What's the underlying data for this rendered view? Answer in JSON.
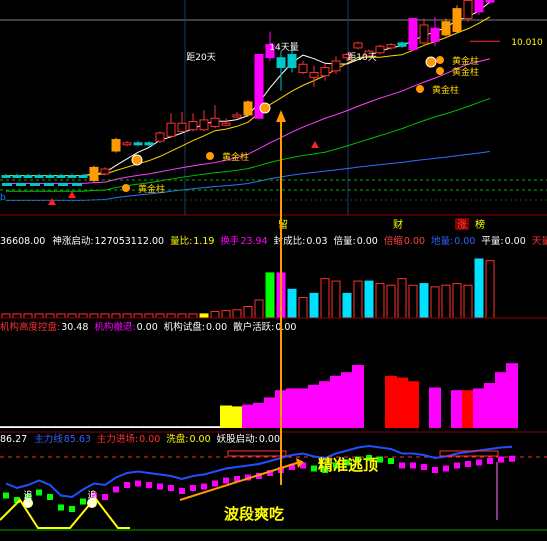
{
  "chart_data": [
    {
      "type": "candlestick",
      "panel": "price",
      "ylim": [
        0,
        11
      ],
      "price_level_label": "10.010",
      "price_level": 10.01,
      "candles": [
        {
          "o": 1.8,
          "c": 1.8,
          "h": 1.9,
          "l": 1.7,
          "col": "#00c8c8"
        },
        {
          "o": 1.8,
          "c": 1.8,
          "h": 1.9,
          "l": 1.7,
          "col": "#00c8c8"
        },
        {
          "o": 1.8,
          "c": 1.8,
          "h": 1.9,
          "l": 1.7,
          "col": "#00c8c8"
        },
        {
          "o": 1.8,
          "c": 1.8,
          "h": 1.9,
          "l": 1.7,
          "col": "#00c8c8"
        },
        {
          "o": 1.8,
          "c": 1.8,
          "h": 1.9,
          "l": 1.7,
          "col": "#00c8c8"
        },
        {
          "o": 1.8,
          "c": 1.8,
          "h": 1.9,
          "l": 1.7,
          "col": "#00c8c8"
        },
        {
          "o": 1.8,
          "c": 1.8,
          "h": 1.9,
          "l": 1.7,
          "col": "#00c8c8"
        },
        {
          "o": 1.8,
          "c": 1.8,
          "h": 1.9,
          "l": 1.7,
          "col": "#00c8c8"
        },
        {
          "o": 1.5,
          "c": 2.3,
          "h": 2.4,
          "l": 1.4,
          "col": "#ff9a00"
        },
        {
          "o": 1.9,
          "c": 2.2,
          "h": 2.3,
          "l": 1.8,
          "col": "#ff3030"
        },
        {
          "o": 3.3,
          "c": 4.0,
          "h": 4.1,
          "l": 3.2,
          "col": "#ff9a00"
        },
        {
          "o": 3.7,
          "c": 3.8,
          "h": 3.9,
          "l": 3.6,
          "col": "#ff3030"
        },
        {
          "o": 3.7,
          "c": 3.8,
          "h": 3.9,
          "l": 3.6,
          "col": "#00c8c8"
        },
        {
          "o": 3.7,
          "c": 3.8,
          "h": 3.9,
          "l": 3.6,
          "col": "#00c8c8"
        },
        {
          "o": 3.9,
          "c": 4.4,
          "h": 4.5,
          "l": 3.8,
          "col": "#ff3030"
        },
        {
          "o": 4.2,
          "c": 5.0,
          "h": 5.6,
          "l": 4.1,
          "col": "#ff3030"
        },
        {
          "o": 4.5,
          "c": 5.0,
          "h": 5.7,
          "l": 4.4,
          "col": "#ff3030"
        },
        {
          "o": 4.6,
          "c": 5.1,
          "h": 5.6,
          "l": 4.5,
          "col": "#ff3030"
        },
        {
          "o": 4.6,
          "c": 5.2,
          "h": 5.8,
          "l": 4.5,
          "col": "#ff3030"
        },
        {
          "o": 4.8,
          "c": 5.3,
          "h": 6.1,
          "l": 4.7,
          "col": "#ff3030"
        },
        {
          "o": 5.0,
          "c": 5.0,
          "h": 5.3,
          "l": 4.8,
          "col": "#ff3030"
        },
        {
          "o": 5.4,
          "c": 5.5,
          "h": 5.7,
          "l": 5.3,
          "col": "#ff3030"
        },
        {
          "o": 5.5,
          "c": 6.3,
          "h": 6.4,
          "l": 5.4,
          "col": "#ff9a00"
        },
        {
          "o": 5.3,
          "c": 9.2,
          "h": 9.2,
          "l": 5.3,
          "col": "#ff00ff"
        },
        {
          "o": 9.0,
          "c": 9.8,
          "h": 10.6,
          "l": 8.8,
          "col": "#ff00ff"
        },
        {
          "o": 8.4,
          "c": 9.0,
          "h": 9.4,
          "l": 7.0,
          "col": "#00c8c8"
        },
        {
          "o": 8.4,
          "c": 9.2,
          "h": 9.9,
          "l": 8.1,
          "col": "#00c8c8"
        },
        {
          "o": 8.1,
          "c": 8.6,
          "h": 8.8,
          "l": 8.0,
          "col": "#ff3030"
        },
        {
          "o": 7.8,
          "c": 8.1,
          "h": 8.5,
          "l": 7.2,
          "col": "#ff3030"
        },
        {
          "o": 7.9,
          "c": 8.4,
          "h": 8.6,
          "l": 7.6,
          "col": "#ff3030"
        },
        {
          "o": 8.2,
          "c": 8.8,
          "h": 9.1,
          "l": 8.0,
          "col": "#ff3030"
        },
        {
          "o": 9.0,
          "c": 9.2,
          "h": 9.3,
          "l": 8.8,
          "col": "#ff3030"
        },
        {
          "o": 9.6,
          "c": 9.9,
          "h": 10.0,
          "l": 9.5,
          "col": "#ff3030"
        },
        {
          "o": 9.1,
          "c": 9.4,
          "h": 9.5,
          "l": 9.0,
          "col": "#ff3030"
        },
        {
          "o": 9.3,
          "c": 9.7,
          "h": 9.8,
          "l": 9.2,
          "col": "#ff3030"
        },
        {
          "o": 9.6,
          "c": 9.8,
          "h": 9.9,
          "l": 9.5,
          "col": "#ff3030"
        },
        {
          "o": 9.7,
          "c": 9.9,
          "h": 10.0,
          "l": 9.6,
          "col": "#00c8c8"
        },
        {
          "o": 9.5,
          "c": 11.4,
          "h": 11.4,
          "l": 9.4,
          "col": "#ff00ff"
        },
        {
          "o": 9.9,
          "c": 11.0,
          "h": 11.4,
          "l": 9.8,
          "col": "#ff3030"
        },
        {
          "o": 10.0,
          "c": 10.8,
          "h": 11.5,
          "l": 9.7,
          "col": "#ff00ff"
        },
        {
          "o": 10.4,
          "c": 11.2,
          "h": 11.4,
          "l": 10.3,
          "col": "#ff9a00"
        },
        {
          "o": 10.6,
          "c": 12.0,
          "h": 12.2,
          "l": 10.5,
          "col": "#ff9a00"
        },
        {
          "o": 11.4,
          "c": 12.5,
          "h": 12.8,
          "l": 11.2,
          "col": "#ff3030"
        },
        {
          "o": 11.8,
          "c": 12.8,
          "h": 13.2,
          "l": 11.6,
          "col": "#ff00ff"
        },
        {
          "o": 12.4,
          "c": 13.6,
          "h": 13.6,
          "l": 12.3,
          "col": "#ff00ff"
        }
      ],
      "annotations": [
        "距20天",
        "14天量",
        "距10天",
        "黄金柱",
        "黄金柱",
        "黄金柱",
        "黄金柱",
        "黄金柱"
      ],
      "markers": [
        "留",
        "财",
        "涨",
        "榜"
      ]
    },
    {
      "type": "bar",
      "panel": "volume",
      "header": [
        {
          "label": "36608.00",
          "value": ""
        },
        {
          "label": "神涨启动:",
          "value": "127053112.00"
        },
        {
          "label": "量比:",
          "value": "1.19"
        },
        {
          "label": "换手",
          "value": "23.94"
        },
        {
          "label": "封成比:",
          "value": "0.03"
        },
        {
          "label": "倍量:",
          "value": "0.00"
        },
        {
          "label": "倍缩",
          "value": "0.00"
        },
        {
          "label": "地量:",
          "value": "0.00"
        },
        {
          "label": "平量:",
          "value": "0.00"
        },
        {
          "label": "天量:",
          "value": ""
        }
      ],
      "values": [
        5,
        5,
        5,
        5,
        5,
        5,
        5,
        5,
        5,
        5,
        5,
        5,
        5,
        5,
        5,
        5,
        5,
        5,
        5,
        8,
        9,
        10,
        14,
        22,
        55,
        55,
        35,
        25,
        30,
        48,
        45,
        30,
        45,
        45,
        42,
        40,
        48,
        40,
        42,
        38,
        40,
        42,
        40,
        72,
        70
      ],
      "colors": [
        "#ff3030",
        "#ff3030",
        "#ff3030",
        "#ff3030",
        "#ff3030",
        "#ff3030",
        "#ff3030",
        "#ff3030",
        "#ff3030",
        "#ff3030",
        "#ff3030",
        "#ff3030",
        "#ff3030",
        "#ff3030",
        "#ff3030",
        "#ff3030",
        "#ff3030",
        "#ff3030",
        "#ffff00",
        "#ff3030",
        "#ff3030",
        "#ff3030",
        "#ff3030",
        "#ff3030",
        "#00ff00",
        "#ff00ff",
        "#00e0ff",
        "#ff3030",
        "#00e0ff",
        "#ff3030",
        "#ff3030",
        "#00e0ff",
        "#ff3030",
        "#00e0ff",
        "#ff3030",
        "#ff3030",
        "#ff3030",
        "#ff3030",
        "#00e0ff",
        "#ff3030",
        "#ff3030",
        "#ff3030",
        "#ff3030",
        "#00e0ff",
        "#ff3030"
      ]
    },
    {
      "type": "bar",
      "panel": "institution",
      "header": [
        {
          "label": "机构高度控盘:",
          "value": "30.48"
        },
        {
          "label": "机构撤退:",
          "value": "0.00"
        },
        {
          "label": "机构试盘:",
          "value": "0.00"
        },
        {
          "label": "散户活跃:",
          "value": "0.00"
        }
      ],
      "values": [
        2,
        2,
        2,
        2,
        2,
        2,
        2,
        2,
        2,
        2,
        2,
        2,
        2,
        2,
        2,
        2,
        2,
        2,
        2,
        2,
        25,
        24,
        26,
        28,
        34,
        42,
        44,
        44,
        48,
        52,
        58,
        62,
        70,
        0,
        0,
        58,
        56,
        52,
        0,
        45,
        0,
        42,
        42,
        44,
        50,
        62,
        72
      ],
      "colors": [
        "#ffffff",
        "#ffffff",
        "#ffffff",
        "#ffffff",
        "#ffffff",
        "#ffffff",
        "#ffffff",
        "#ffffff",
        "#ffffff",
        "#ffffff",
        "#ffffff",
        "#ffffff",
        "#ffffff",
        "#ffffff",
        "#ffffff",
        "#ffffff",
        "#ffffff",
        "#ffffff",
        "#ffffff",
        "#ffffff",
        "#ffff00",
        "#ffff00",
        "#ff00ff",
        "#ff00ff",
        "#ff00ff",
        "#ff00ff",
        "#ff00ff",
        "#ff00ff",
        "#ff00ff",
        "#ff00ff",
        "#ff00ff",
        "#ff00ff",
        "#ff00ff",
        "#ff00ff",
        "#ff00ff",
        "#ff0000",
        "#ff0000",
        "#ff0000",
        "#ff0000",
        "#ff00ff",
        "#ff0000",
        "#ff00ff",
        "#ff0000",
        "#ff00ff",
        "#ff00ff",
        "#ff00ff",
        "#ff00ff"
      ]
    },
    {
      "type": "line",
      "panel": "oscillator",
      "header": [
        {
          "label": "86.27",
          "value": ""
        },
        {
          "label": "主力线",
          "value": "85.63"
        },
        {
          "label": "主力进场:",
          "value": "0.00"
        },
        {
          "label": "洗盘:",
          "value": "0.00"
        },
        {
          "label": "妖股启动:",
          "value": "0.00"
        }
      ],
      "main_line": [
        46,
        40,
        44,
        50,
        44,
        30,
        28,
        38,
        46,
        44,
        54,
        60,
        62,
        60,
        58,
        56,
        52,
        56,
        58,
        62,
        66,
        68,
        70,
        72,
        76,
        80,
        84,
        86,
        82,
        80,
        86,
        90,
        94,
        96,
        94,
        92,
        86,
        86,
        84,
        80,
        82,
        86,
        88,
        90,
        92,
        94,
        95
      ],
      "annotations": [
        "精准逃顶",
        "波段爽吃",
        "追",
        "追"
      ]
    }
  ]
}
